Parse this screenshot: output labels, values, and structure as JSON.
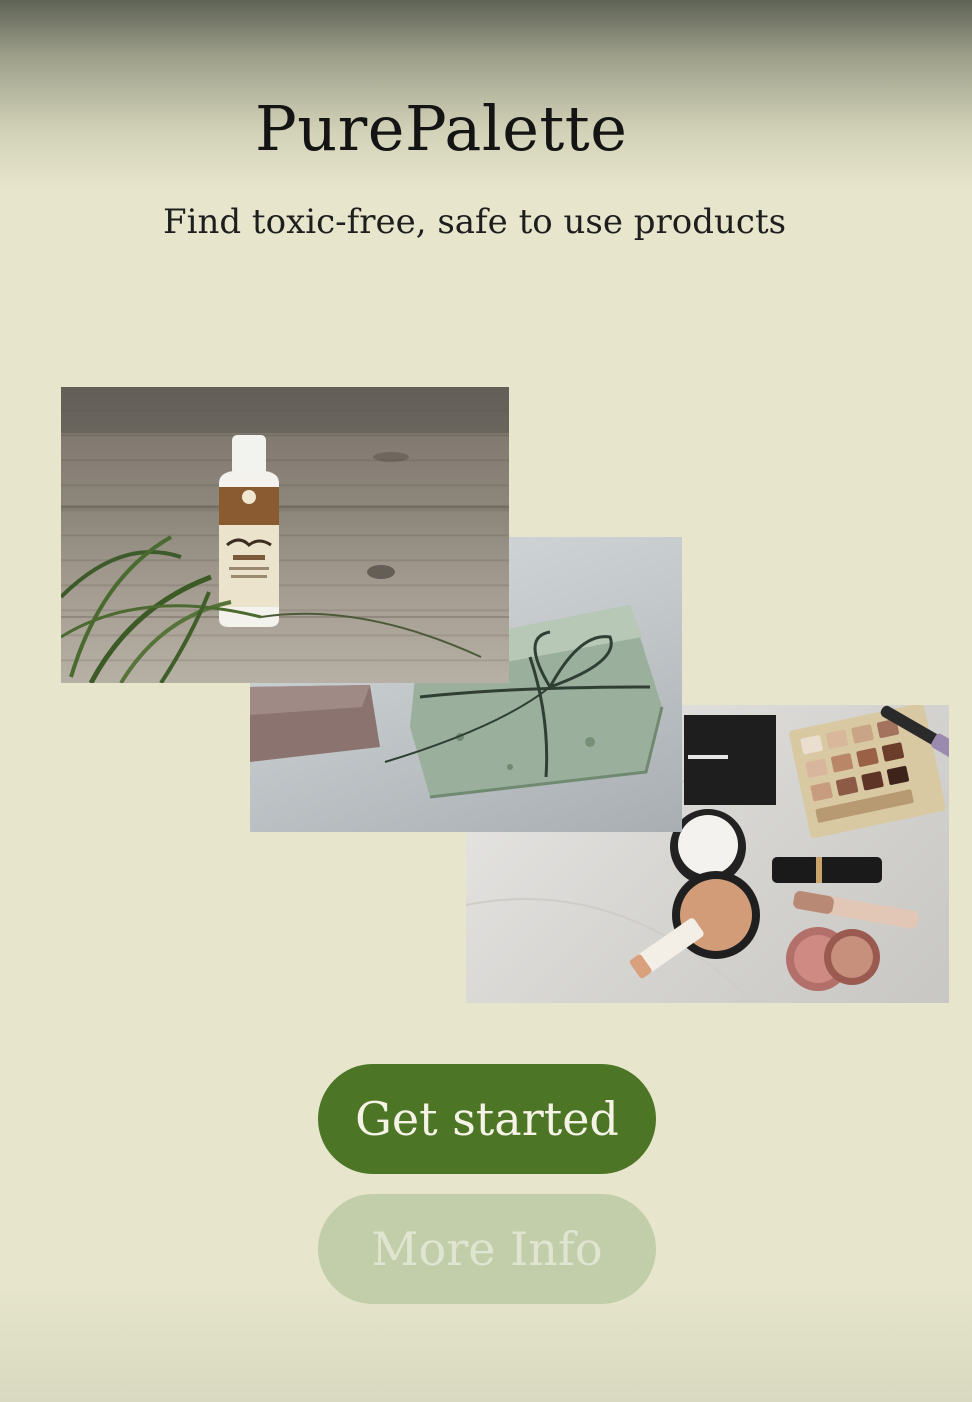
{
  "header": {
    "app_title": "PurePalette",
    "tagline": "Find toxic-free, safe to use products"
  },
  "collage": {
    "images": [
      "lotion-bottle-photo",
      "soap-bars-photo",
      "makeup-products-photo"
    ]
  },
  "actions": {
    "get_started_label": "Get started",
    "more_info_label": "More Info"
  },
  "colors": {
    "background": "#e7e6cc",
    "primary_button": "#4d7526",
    "secondary_button": "#c2ceaa"
  }
}
